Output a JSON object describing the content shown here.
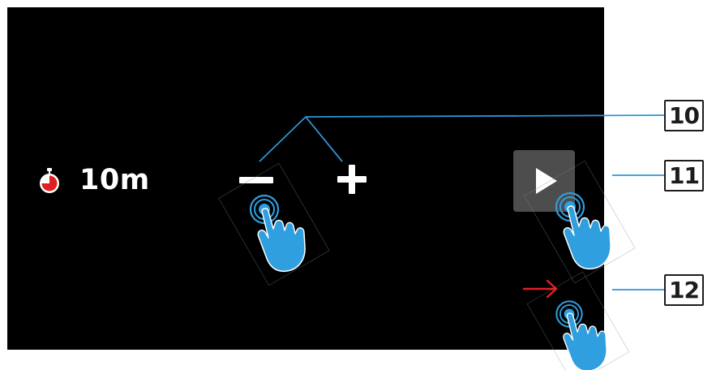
{
  "timer": {
    "icon": "stopwatch-icon",
    "value": "10m",
    "accent_color": "#e02020"
  },
  "controls": {
    "decrease_icon": "minus-icon",
    "increase_icon": "plus-icon",
    "play_icon": "play-icon",
    "next_icon": "arrow-right-icon",
    "next_color": "#e02020",
    "play_background": "#4d4d4d"
  },
  "annotations": {
    "callouts": [
      "10",
      "11",
      "12"
    ],
    "gesture_icon": "tap-hand-icon",
    "leader_line_color": "#2b96d9",
    "hand_color": "#2f9fe0"
  }
}
